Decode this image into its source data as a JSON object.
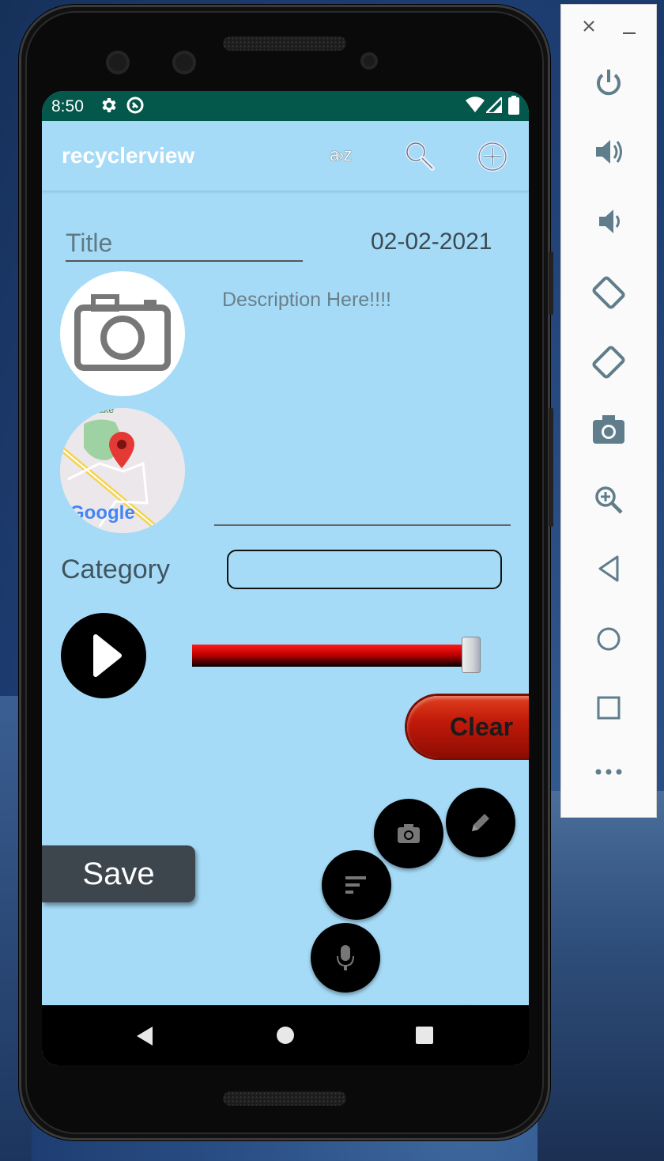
{
  "status_bar": {
    "time": "8:50"
  },
  "app_bar": {
    "title": "recyclerview",
    "sort_label": "a›z"
  },
  "form": {
    "title_placeholder": "Title",
    "date": "02-02-2021",
    "description_placeholder": "Description Here!!!!",
    "category_label": "Category",
    "category_value": "",
    "map_labels": {
      "logo": "Google",
      "place": "Lake"
    },
    "audio_progress": 0.97
  },
  "buttons": {
    "clear_label": "Clear",
    "save_label": "Save"
  },
  "fab_menu": {
    "items": [
      "camera-icon",
      "pencil-icon",
      "sort-lines-icon",
      "mic-icon"
    ],
    "main_icon": "close-icon"
  },
  "emulator_toolbar": {
    "items": [
      "power",
      "volume-up",
      "volume-down",
      "rotate-left",
      "rotate-right",
      "screenshot",
      "zoom",
      "back",
      "home",
      "overview",
      "more"
    ]
  },
  "colors": {
    "screen_bg": "#a6dbf7",
    "status_bar": "#04574b",
    "fab_main": "#6a3fb8",
    "clear_button": "#c21a0a",
    "save_button": "#3d464d"
  }
}
